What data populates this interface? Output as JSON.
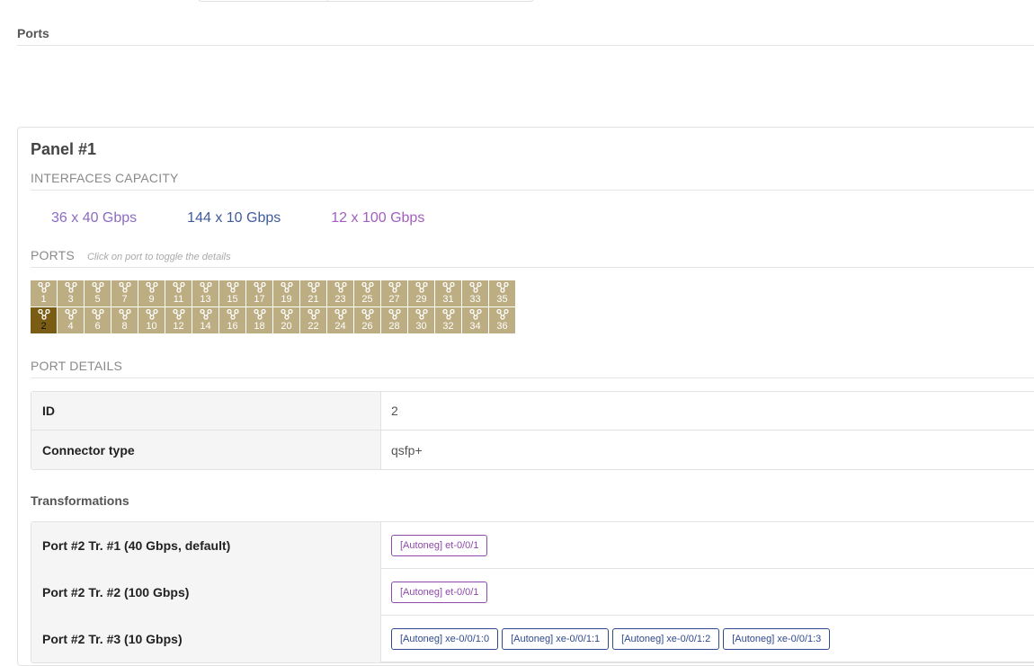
{
  "colors": {
    "cap40": "#8b6bc4",
    "cap10": "#3e5b9e",
    "cap100": "#a35fbf",
    "port": "#bcad82",
    "port_selected": "#7a5c14",
    "tag_purple": "#8e4aa8",
    "tag_blue": "#2f4a8f"
  },
  "section": {
    "title": "Ports"
  },
  "panel": {
    "title": "Panel #1",
    "capacity_heading": "INTERFACES CAPACITY",
    "capacities": [
      {
        "text": "36 x 40 Gbps",
        "color": "#8b6bc4"
      },
      {
        "text": "144 x 10 Gbps",
        "color": "#3e5b9e"
      },
      {
        "text": "12 x 100 Gbps",
        "color": "#a35fbf"
      }
    ],
    "ports_heading": "PORTS",
    "ports_hint": "Click on port to toggle the details",
    "ports_row_top": [
      "1",
      "3",
      "5",
      "7",
      "9",
      "11",
      "13",
      "15",
      "17",
      "19",
      "21",
      "23",
      "25",
      "27",
      "29",
      "31",
      "33",
      "35"
    ],
    "ports_row_bottom": [
      "2",
      "4",
      "6",
      "8",
      "10",
      "12",
      "14",
      "16",
      "18",
      "20",
      "22",
      "24",
      "26",
      "28",
      "30",
      "32",
      "34",
      "36"
    ],
    "selected_port": "2",
    "details_heading": "PORT DETAILS",
    "details": [
      {
        "key": "ID",
        "value": "2"
      },
      {
        "key": "Connector type",
        "value": "qsfp+"
      }
    ],
    "transformations_heading": "Transformations",
    "transformations": [
      {
        "label": "Port #2 Tr. #1 (40 Gbps, default)",
        "tags": [
          {
            "text": "[Autoneg] et-0/0/1",
            "color": "#8e4aa8"
          }
        ]
      },
      {
        "label": "Port #2 Tr. #2 (100 Gbps)",
        "tags": [
          {
            "text": "[Autoneg] et-0/0/1",
            "color": "#8e4aa8"
          }
        ]
      },
      {
        "label": "Port #2 Tr. #3 (10 Gbps)",
        "tags": [
          {
            "text": "[Autoneg] xe-0/0/1:0",
            "color": "#2f4a8f"
          },
          {
            "text": "[Autoneg] xe-0/0/1:1",
            "color": "#2f4a8f"
          },
          {
            "text": "[Autoneg] xe-0/0/1:2",
            "color": "#2f4a8f"
          },
          {
            "text": "[Autoneg] xe-0/0/1:3",
            "color": "#2f4a8f"
          }
        ]
      }
    ]
  },
  "icons": {
    "port": "port-connector-icon"
  }
}
